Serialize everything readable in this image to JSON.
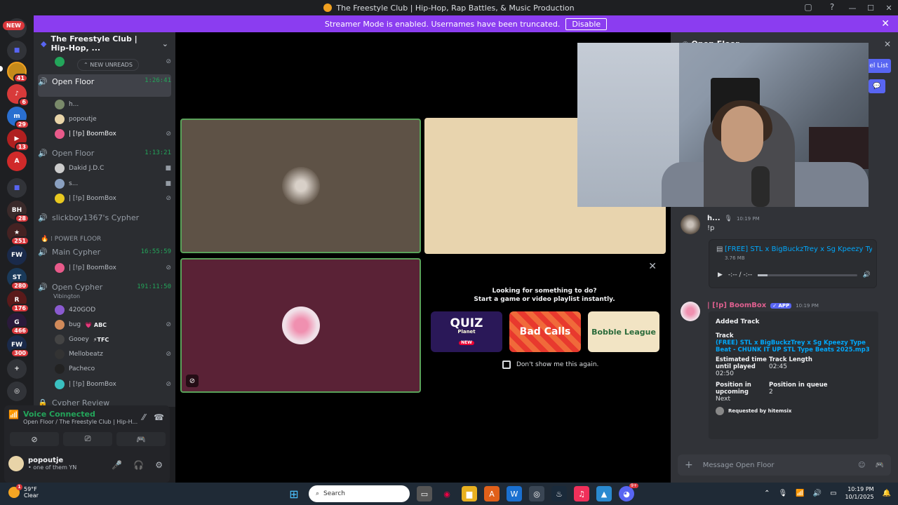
{
  "window": {
    "title": "The Freestyle Club | Hip-Hop, Rap Battles, & Music Production"
  },
  "streamer_banner": {
    "text": "Streamer Mode is enabled. Usernames have been truncated.",
    "button": "Disable"
  },
  "guilds": {
    "new_label": "NEW",
    "badges": [
      "41",
      "6",
      "29",
      "13",
      "28",
      "251",
      "280",
      "176",
      "466",
      "300"
    ]
  },
  "server": {
    "name": "The Freestyle Club | Hip-Hop, ...",
    "new_unreads": "NEW UNREADS",
    "channels": [
      {
        "name": "Open Floor",
        "time": "1:26:41"
      },
      {
        "name": "Open Floor",
        "time": "1:13:21"
      },
      {
        "name": "slickboy1367's Cypher",
        "time": ""
      },
      {
        "name": "Main Cypher",
        "time": "16:55:59"
      },
      {
        "name": "Open Cypher",
        "time": "191:11:50",
        "sub": "Vibington"
      },
      {
        "name": "Cypher Review",
        "time": ""
      }
    ],
    "category": "POWER FLOOR",
    "users": {
      "u1": "h...",
      "u2": "popoutje",
      "u3": "| [!p] BoomBox",
      "u4": "Dakid J.D.C",
      "u5": "s...",
      "u6": "| [!p] BoomBox",
      "u7": "| [!p] BoomBox",
      "u8": "420GOD",
      "u9": "bug",
      "u9_tag": "ABC",
      "u10": "Gooey",
      "u10_tag": "TFC",
      "u11": "Mellobeatz",
      "u12": "Pacheco",
      "u13": "| [!p] BoomBox"
    }
  },
  "voice_panel": {
    "status": "Voice Connected",
    "location": "Open Floor / The Freestyle Club | Hip-H...",
    "user_name": "popoutje",
    "user_status": "one of them YN"
  },
  "activity": {
    "heading": "Looking for something to do?",
    "subheading": "Start a game or video playlist instantly.",
    "games": [
      "QUIZ",
      "Planet",
      "NEW",
      "Bad Calls",
      "Bobble League"
    ],
    "dont_show": "Don't show me this again."
  },
  "chat": {
    "header_channel": "Open Floor",
    "list_button": "el List",
    "msg1": {
      "author": "h...",
      "time": "10:19 PM",
      "text": "!p",
      "file_name": "[FREE] STL x BigBuckzTrey x Sg Kpeezy Type B",
      "file_size": "3.76 MB",
      "player_time": "-:-- / -:--"
    },
    "msg2": {
      "author": "| [!p] BoomBox",
      "app_tag": "APP",
      "time": "10:19 PM",
      "embed_title": "Added Track",
      "track_label": "Track",
      "track_link": "(FREE) STL x BigBuckzTrey x Sg Kpeezy Type Beat - CHUNK IT UP STL Type Beats 2025.mp3",
      "est_label": "Estimated time until played",
      "est_value": "02:50",
      "len_label": "Track Length",
      "len_value": "02:45",
      "pos_up_label": "Position in upcoming",
      "pos_up_value": "Next",
      "pos_q_label": "Position in queue",
      "pos_q_value": "2",
      "requested": "Requested by hitemsix"
    },
    "composer_placeholder": "Message Open Floor"
  },
  "taskbar": {
    "temp": "59°F",
    "weather": "Clear",
    "search": "Search",
    "time": "10:19 PM",
    "date": "10/1/2025",
    "discord_badge": "9+"
  }
}
